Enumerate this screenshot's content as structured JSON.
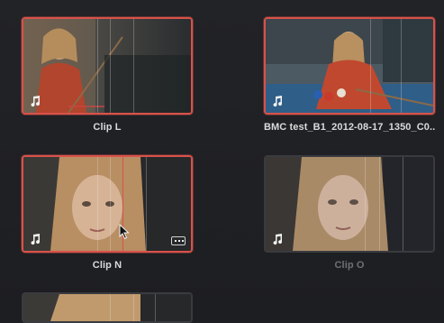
{
  "clips": [
    {
      "name": "Clip L",
      "selected": true,
      "has_audio": true,
      "icon": "music-note-icon"
    },
    {
      "name": "BMC test_B1_2012-08-17_1350_C0...",
      "selected": true,
      "has_audio": true,
      "icon": "music-note-icon"
    },
    {
      "name": "Clip N",
      "selected": true,
      "has_audio": true,
      "icon": "music-note-icon",
      "badge_icon": "more-icon"
    },
    {
      "name": "Clip O",
      "selected": false,
      "has_audio": true,
      "icon": "music-note-icon"
    },
    {
      "name": "",
      "selected": false,
      "has_audio": false
    }
  ],
  "colors": {
    "selection": "#d8524a",
    "background": "#1e1f22",
    "label": "#d9dadb",
    "label_dim": "#6e7074"
  },
  "cursor_icon": "mouse-pointer-icon"
}
